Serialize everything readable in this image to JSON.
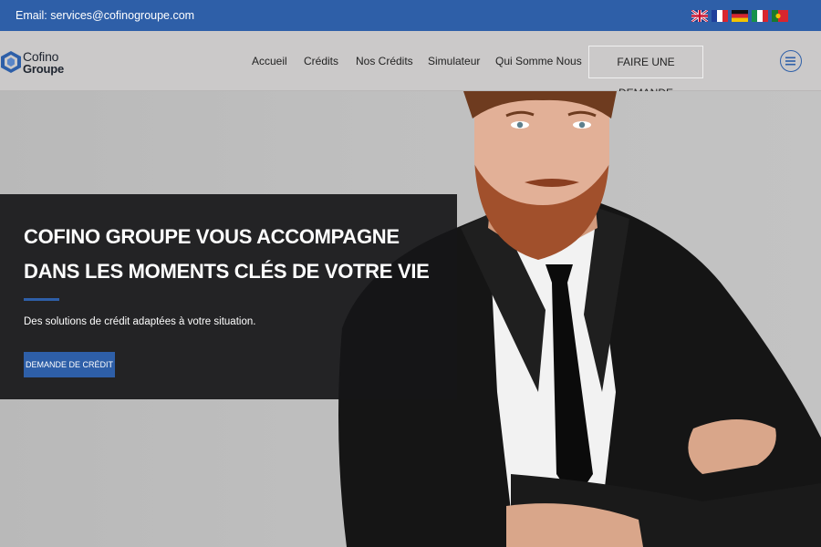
{
  "topbar": {
    "email": "Email: services@cofinogroupe.com",
    "languages": [
      {
        "name": "uk-flag-icon"
      },
      {
        "name": "france-flag-icon"
      },
      {
        "name": "germany-flag-icon"
      },
      {
        "name": "italy-flag-icon"
      },
      {
        "name": "portugal-flag-icon"
      }
    ],
    "bg_color": "#2e5fa8"
  },
  "header": {
    "logo_line1": "Cofino",
    "logo_line2": "Groupe",
    "nav": [
      "Accueil",
      "Crédits",
      "Nos Crédits",
      "Simulateur",
      "Qui Somme Nous"
    ],
    "cta_label": "FAIRE UNE DEMANDE",
    "menu_icon": "hamburger-menu-icon"
  },
  "hero": {
    "title_line1": "COFINO GROUPE VOUS ACCOMPAGNE",
    "title_line2": "DANS LES MOMENTS CLÉS DE VOTRE VIE",
    "subtitle": "Des solutions de crédit adaptées à votre situation.",
    "button_label": "DEMANDE DE CRÉDIT",
    "accent_color": "#2e5fa8"
  }
}
